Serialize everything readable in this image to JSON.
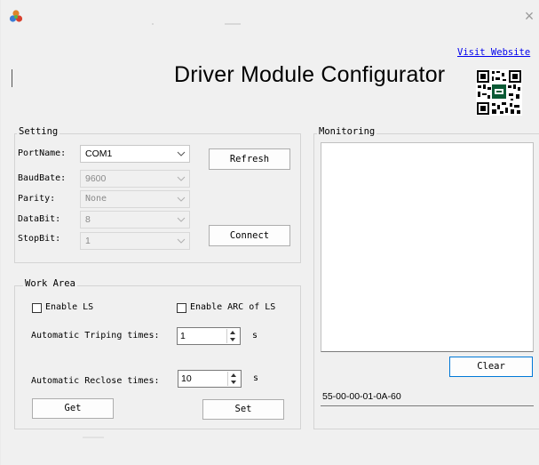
{
  "window": {
    "close_glyph": "×",
    "title": "Driver Module Configurator",
    "visit_link": "Visit Website",
    "app_icon": "app-logo-icon",
    "qr_icon": "qr-code-icon"
  },
  "setting": {
    "title": "Setting",
    "port_label": "PortName:",
    "port_value": "COM1",
    "baud_label": "BaudBate:",
    "baud_value": "9600",
    "parity_label": "Parity:",
    "parity_value": "None",
    "databit_label": "DataBit:",
    "databit_value": "8",
    "stopbit_label": "StopBit:",
    "stopbit_value": "1",
    "refresh_label": "Refresh",
    "connect_label": "Connect"
  },
  "work_area": {
    "title": "Work Area",
    "enable_ls_label": "Enable LS",
    "enable_ls_checked": false,
    "enable_arc_label": "Enable ARC of LS",
    "enable_arc_checked": false,
    "trip_label": "Automatic Triping times:",
    "trip_value": "1",
    "trip_unit": "s",
    "reclose_label": "Automatic Reclose times:",
    "reclose_value": "10",
    "reclose_unit": "s",
    "get_label": "Get",
    "set_label": "Set"
  },
  "monitoring": {
    "title": "Monitoring",
    "clear_label": "Clear",
    "status_value": "55-00-00-01-0A-60"
  },
  "colors": {
    "window_bg": "#f0f0f0",
    "link": "#0000ee",
    "focus_border": "#0078d7"
  }
}
